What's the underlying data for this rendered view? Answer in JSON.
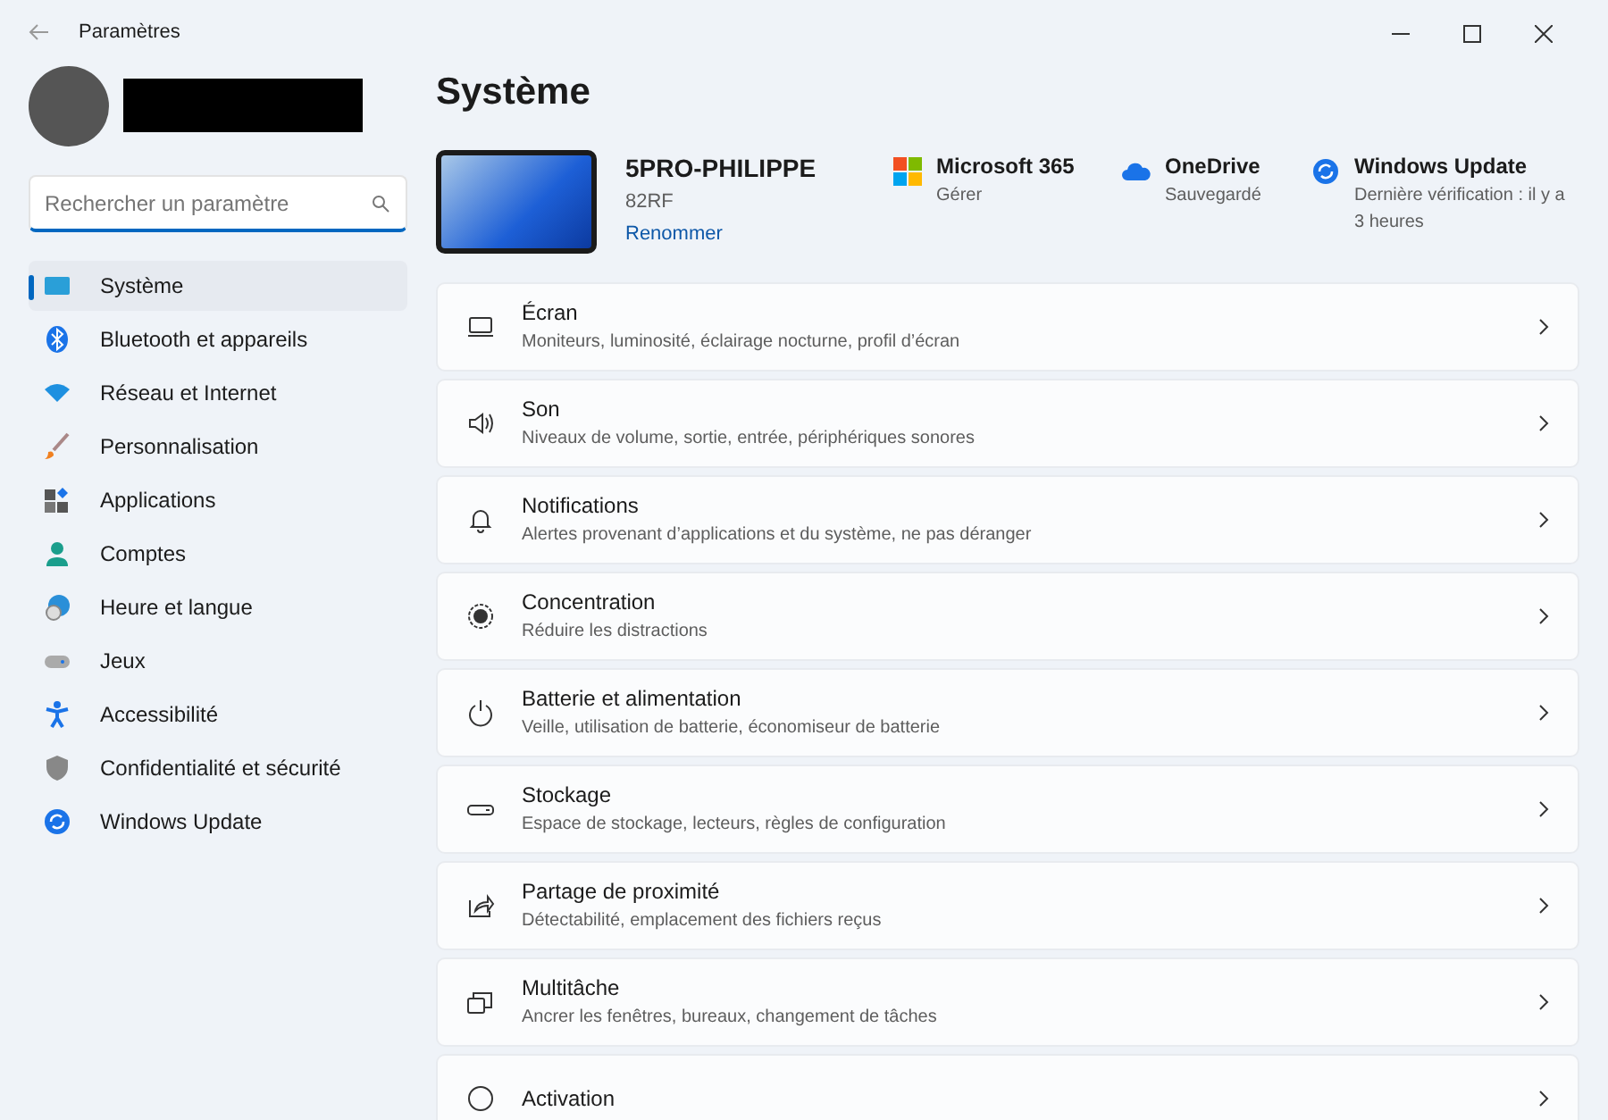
{
  "window": {
    "title": "Paramètres"
  },
  "search": {
    "placeholder": "Rechercher un paramètre"
  },
  "sidebar": {
    "items": [
      {
        "label": "Système",
        "selected": true
      },
      {
        "label": "Bluetooth et appareils",
        "selected": false
      },
      {
        "label": "Réseau et Internet",
        "selected": false
      },
      {
        "label": "Personnalisation",
        "selected": false
      },
      {
        "label": "Applications",
        "selected": false
      },
      {
        "label": "Comptes",
        "selected": false
      },
      {
        "label": "Heure et langue",
        "selected": false
      },
      {
        "label": "Jeux",
        "selected": false
      },
      {
        "label": "Accessibilité",
        "selected": false
      },
      {
        "label": "Confidentialité et sécurité",
        "selected": false
      },
      {
        "label": "Windows Update",
        "selected": false
      }
    ]
  },
  "page_title": "Système",
  "device": {
    "name": "5PRO-PHILIPPE",
    "model": "82RF",
    "rename_link": "Renommer"
  },
  "quick_links": [
    {
      "title": "Microsoft 365",
      "subtitle": "Gérer"
    },
    {
      "title": "OneDrive",
      "subtitle": "Sauvegardé"
    },
    {
      "title": "Windows Update",
      "subtitle": "Dernière vérification : il y a 3 heures"
    }
  ],
  "settings": [
    {
      "title": "Écran",
      "description": "Moniteurs, luminosité, éclairage nocturne, profil d’écran"
    },
    {
      "title": "Son",
      "description": "Niveaux de volume, sortie, entrée, périphériques sonores"
    },
    {
      "title": "Notifications",
      "description": "Alertes provenant d’applications et du système, ne pas déranger"
    },
    {
      "title": "Concentration",
      "description": "Réduire les distractions"
    },
    {
      "title": "Batterie et alimentation",
      "description": "Veille, utilisation de batterie, économiseur de batterie"
    },
    {
      "title": "Stockage",
      "description": "Espace de stockage, lecteurs, règles de configuration"
    },
    {
      "title": "Partage de proximité",
      "description": "Détectabilité, emplacement des fichiers reçus"
    },
    {
      "title": "Multitâche",
      "description": "Ancrer les fenêtres, bureaux, changement de tâches"
    },
    {
      "title": "Activation"
    }
  ]
}
